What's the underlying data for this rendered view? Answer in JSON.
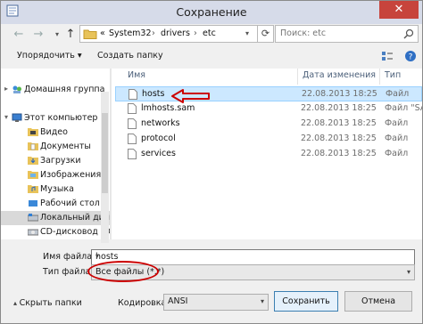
{
  "window": {
    "title": "Сохранение",
    "close_glyph": "✕"
  },
  "nav_buttons": {
    "back": "←",
    "forward": "→",
    "up": "↑"
  },
  "address": {
    "prefix": "«",
    "crumbs": [
      "System32",
      "drivers",
      "etc"
    ],
    "separator": "›"
  },
  "search": {
    "placeholder": "Поиск: etc"
  },
  "toolbar": {
    "organize": "Упорядочить ▾",
    "new_folder": "Создать папку"
  },
  "nav_pane": {
    "items": [
      {
        "label": "Домашняя группа",
        "icon": "homegroup-icon"
      },
      {
        "label": "Этот компьютер",
        "icon": "computer-icon"
      },
      {
        "label": "Видео",
        "icon": "video-folder-icon"
      },
      {
        "label": "Документы",
        "icon": "documents-folder-icon"
      },
      {
        "label": "Загрузки",
        "icon": "downloads-folder-icon"
      },
      {
        "label": "Изображения",
        "icon": "pictures-folder-icon"
      },
      {
        "label": "Музыка",
        "icon": "music-folder-icon"
      },
      {
        "label": "Рабочий стол",
        "icon": "desktop-folder-icon"
      },
      {
        "label": "Локальный диск",
        "icon": "local-disk-icon"
      },
      {
        "label": "CD-дисковод (D:",
        "icon": "cd-drive-icon"
      }
    ]
  },
  "columns": {
    "name": "Имя",
    "date": "Дата изменения",
    "type": "Тип"
  },
  "files": [
    {
      "name": "hosts",
      "date": "22.08.2013 18:25",
      "type": "Файл",
      "selected": true
    },
    {
      "name": "lmhosts.sam",
      "date": "22.08.2013 18:25",
      "type": "Файл \"SA",
      "selected": false
    },
    {
      "name": "networks",
      "date": "22.08.2013 18:25",
      "type": "Файл",
      "selected": false
    },
    {
      "name": "protocol",
      "date": "22.08.2013 18:25",
      "type": "Файл",
      "selected": false
    },
    {
      "name": "services",
      "date": "22.08.2013 18:25",
      "type": "Файл",
      "selected": false
    }
  ],
  "form": {
    "filename_label": "Имя файла:",
    "filename_value": "hosts",
    "filetype_label": "Тип файла:",
    "filetype_value": "Все файлы (*.*)",
    "hide_folders": "Скрыть папки",
    "encoding_label": "Кодировка:",
    "encoding_value": "ANSI",
    "save": "Сохранить",
    "cancel": "Отмена"
  },
  "colors": {
    "selection": "#cce8ff",
    "annotation": "#cc0000",
    "close": "#c7443c"
  }
}
